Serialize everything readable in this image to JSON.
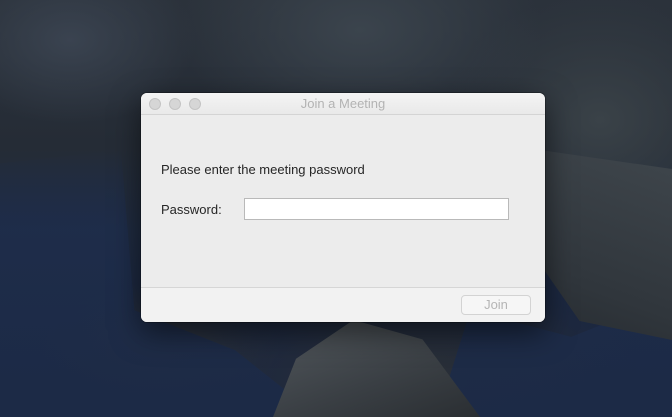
{
  "window": {
    "title": "Join a Meeting",
    "prompt": "Please enter the meeting password",
    "password_label": "Password:",
    "password_value": "",
    "join_label": "Join"
  },
  "colors": {
    "window_bg": "#ececec",
    "title_text": "#b3b3b3",
    "disabled_button_text": "#b5b5b5"
  }
}
